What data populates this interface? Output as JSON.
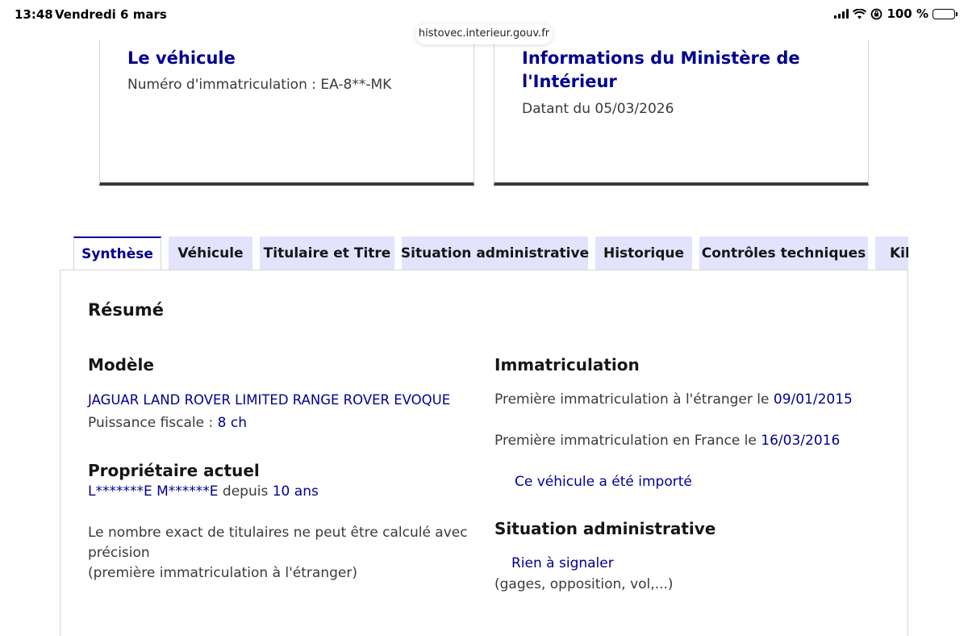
{
  "status_bar": {
    "time": "13:48",
    "date": "Vendredi 6 mars",
    "battery": "100 %",
    "icons": [
      "signal-icon",
      "wifi-icon",
      "rotation-lock-icon",
      "battery-icon"
    ]
  },
  "browser": {
    "url": "histovec.interieur.gouv.fr"
  },
  "cards": {
    "vehicle": {
      "title": "Le véhicule",
      "plate_label": "Numéro d'immatriculation : ",
      "plate_value": "EA-8**-MK"
    },
    "ministry": {
      "title_line1": "Informations du Ministère de",
      "title_line2": "l'Intérieur",
      "date_label": "Datant du ",
      "date_value": "05/03/2026"
    }
  },
  "tabs": [
    {
      "label": "Synthèse",
      "active": true
    },
    {
      "label": "Véhicule",
      "active": false
    },
    {
      "label": "Titulaire et Titre",
      "active": false
    },
    {
      "label": "Situation administrative",
      "active": false
    },
    {
      "label": "Historique",
      "active": false
    },
    {
      "label": "Contrôles techniques",
      "active": false
    },
    {
      "label": "Kilométrage",
      "active": false
    }
  ],
  "summary": {
    "title": "Résumé",
    "model": {
      "heading": "Modèle",
      "name": "JAGUAR LAND ROVER LIMITED RANGE ROVER EVOQUE",
      "power_label": "Puissance fiscale : ",
      "power_value": "8 ch"
    },
    "owner": {
      "heading": "Propriétaire actuel",
      "name": "L*******E M******E",
      "since_label": " depuis ",
      "since_value": "10 ans",
      "note_line1": "Le nombre exact de titulaires ne peut être calculé avec",
      "note_line2": "précision",
      "note_line3": "(première immatriculation à l'étranger)"
    },
    "registration": {
      "heading": "Immatriculation",
      "foreign_label": "Première immatriculation à l'étranger le ",
      "foreign_date": "09/01/2015",
      "france_label": "Première immatriculation en France le ",
      "france_date": "16/03/2016",
      "imported_text": "Ce véhicule a été importé"
    },
    "admin": {
      "heading": "Situation administrative",
      "status": "Rien à signaler",
      "detail": "(gages, opposition, vol,...)"
    }
  },
  "colors": {
    "accent": "#000091",
    "tab_background": "#e3e3fd",
    "card_border_bottom": "#3a3a3a"
  }
}
